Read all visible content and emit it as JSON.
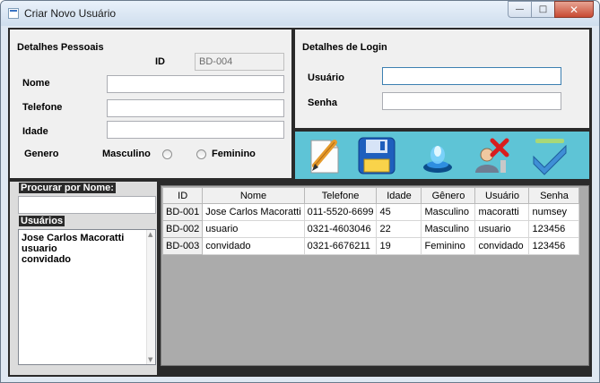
{
  "window": {
    "title": "Criar Novo Usuário",
    "close_glyph": "✕",
    "min_glyph": "—",
    "max_glyph": "□"
  },
  "personal": {
    "title": "Detalhes Pessoais",
    "id_label": "ID",
    "id_value": "BD-004",
    "nome_label": "Nome",
    "telefone_label": "Telefone",
    "idade_label": "Idade",
    "genero_label": "Genero",
    "masculino_label": "Masculino",
    "feminino_label": "Feminino"
  },
  "login": {
    "title": "Detalhes de Login",
    "usuario_label": "Usuário",
    "senha_label": "Senha"
  },
  "toolbar": {
    "icons": [
      "pencil-edit-icon",
      "floppy-save-icon",
      "blue-lamp-icon",
      "user-delete-icon",
      "check-icon"
    ]
  },
  "search": {
    "label": "Procurar por Nome:",
    "value": ""
  },
  "users_list": {
    "label": "Usuários",
    "items": [
      "Jose Carlos Macoratti",
      "usuario",
      "convidado"
    ]
  },
  "grid": {
    "columns": [
      "ID",
      "Nome",
      "Telefone",
      "Idade",
      "Gênero",
      "Usuário",
      "Senha"
    ],
    "rows": [
      [
        "BD-001",
        "Jose Carlos Macoratti",
        "011-5520-6699",
        "45",
        "Masculino",
        "macoratti",
        "numsey"
      ],
      [
        "BD-002",
        "usuario",
        "0321-4603046",
        "22",
        "Masculino",
        "usuario",
        "123456"
      ],
      [
        "BD-003",
        "convidado",
        "0321-6676211",
        "19",
        "Feminino",
        "convidado",
        "123456"
      ]
    ]
  },
  "colors": {
    "toolbar_bg": "#5ec4d6",
    "grid_bg": "#ababab",
    "client_bg": "#2a2a2a"
  }
}
